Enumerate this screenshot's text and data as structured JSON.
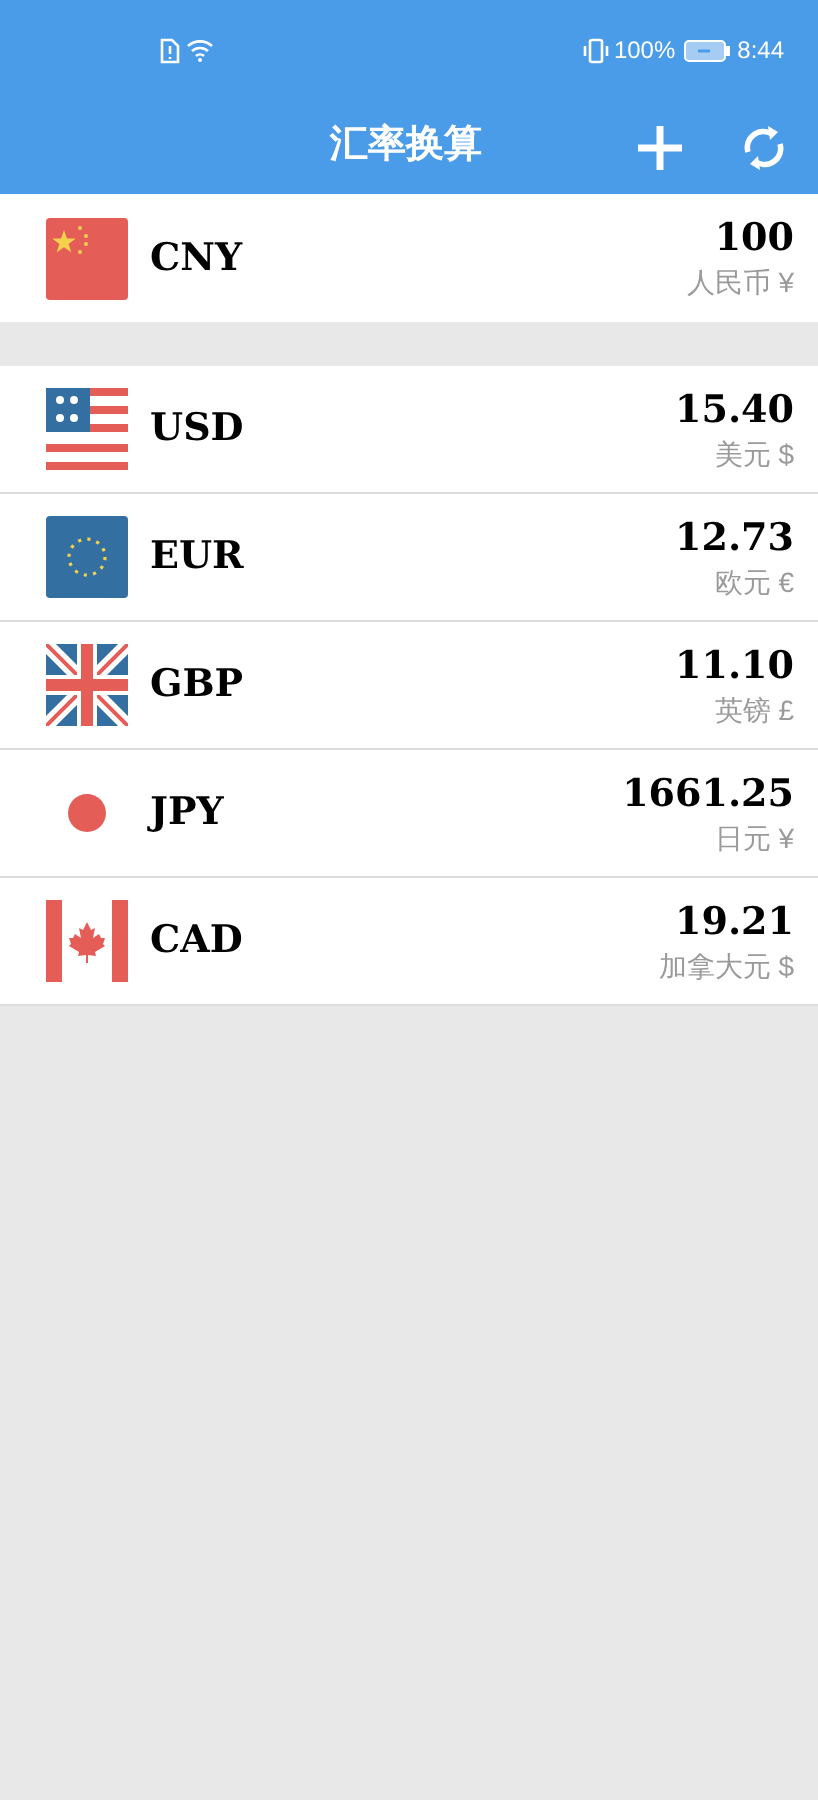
{
  "status_bar": {
    "battery": "100%",
    "time": "8:44"
  },
  "header": {
    "title": "汇率换算"
  },
  "base": {
    "kind": "cn",
    "code": "CNY",
    "amount": "100",
    "name": "人民币 ¥"
  },
  "currencies": [
    {
      "kind": "us",
      "code": "USD",
      "amount": "15.40",
      "name": "美元 $"
    },
    {
      "kind": "eu",
      "code": "EUR",
      "amount": "12.73",
      "name": "欧元 €"
    },
    {
      "kind": "gb",
      "code": "GBP",
      "amount": "11.10",
      "name": "英镑 £"
    },
    {
      "kind": "jp",
      "code": "JPY",
      "amount": "1661.25",
      "name": "日元 ¥"
    },
    {
      "kind": "ca",
      "code": "CAD",
      "amount": "19.21",
      "name": "加拿大元 $"
    }
  ]
}
